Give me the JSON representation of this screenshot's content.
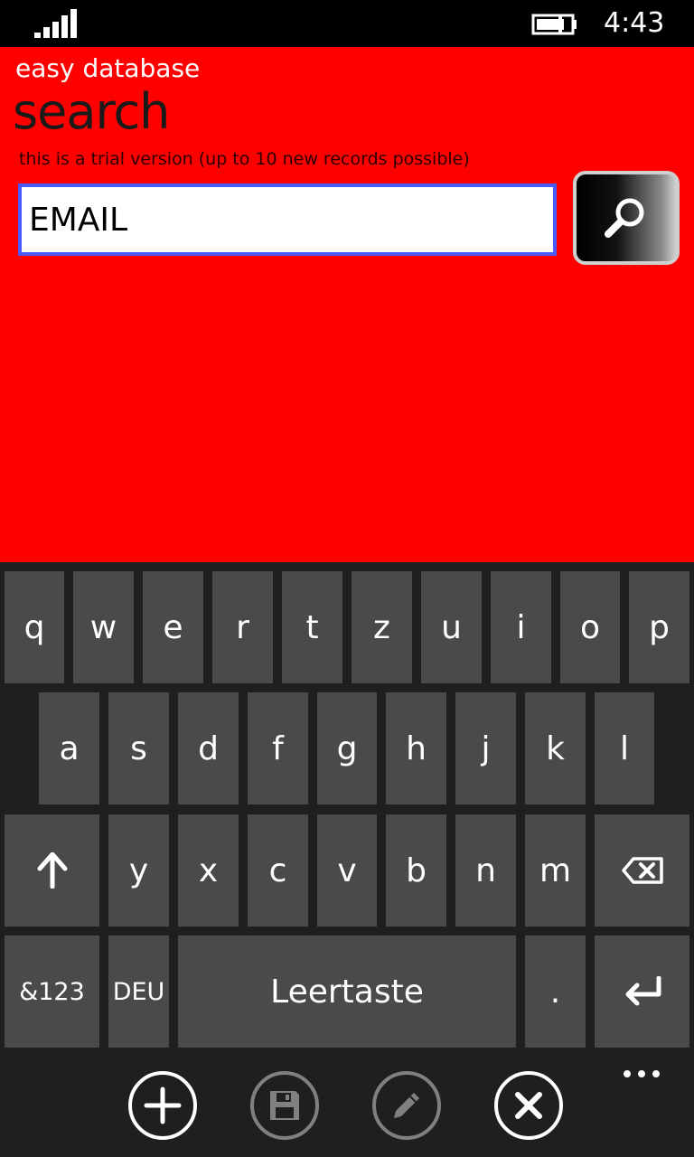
{
  "status_bar": {
    "time": "4:43",
    "signal_icon": "signal-strength-icon",
    "battery_icon": "battery-charging-icon"
  },
  "app": {
    "app_title": "easy database",
    "page_title": "search",
    "trial_note": "this is a trial version (up to 10 new records possible)",
    "search": {
      "value": "EMAIL",
      "placeholder": ""
    },
    "search_button_icon": "magnifier-icon",
    "background_color": "#ff0000"
  },
  "keyboard": {
    "row1": [
      "q",
      "w",
      "e",
      "r",
      "t",
      "z",
      "u",
      "i",
      "o",
      "p"
    ],
    "row2": [
      "a",
      "s",
      "d",
      "f",
      "g",
      "h",
      "j",
      "k",
      "l"
    ],
    "row3": [
      "y",
      "x",
      "c",
      "v",
      "b",
      "n",
      "m"
    ],
    "shift_icon": "shift-arrow-up-icon",
    "backspace_icon": "backspace-icon",
    "symbols_label": "&123",
    "language_label": "DEU",
    "space_label": "Leertaste",
    "period_label": ".",
    "enter_icon": "enter-icon"
  },
  "app_bar": {
    "buttons": [
      {
        "icon": "add-icon",
        "enabled": true
      },
      {
        "icon": "save-icon",
        "enabled": false
      },
      {
        "icon": "edit-icon",
        "enabled": false
      },
      {
        "icon": "close-icon",
        "enabled": true
      }
    ],
    "more_icon": "more-ellipsis-icon"
  }
}
